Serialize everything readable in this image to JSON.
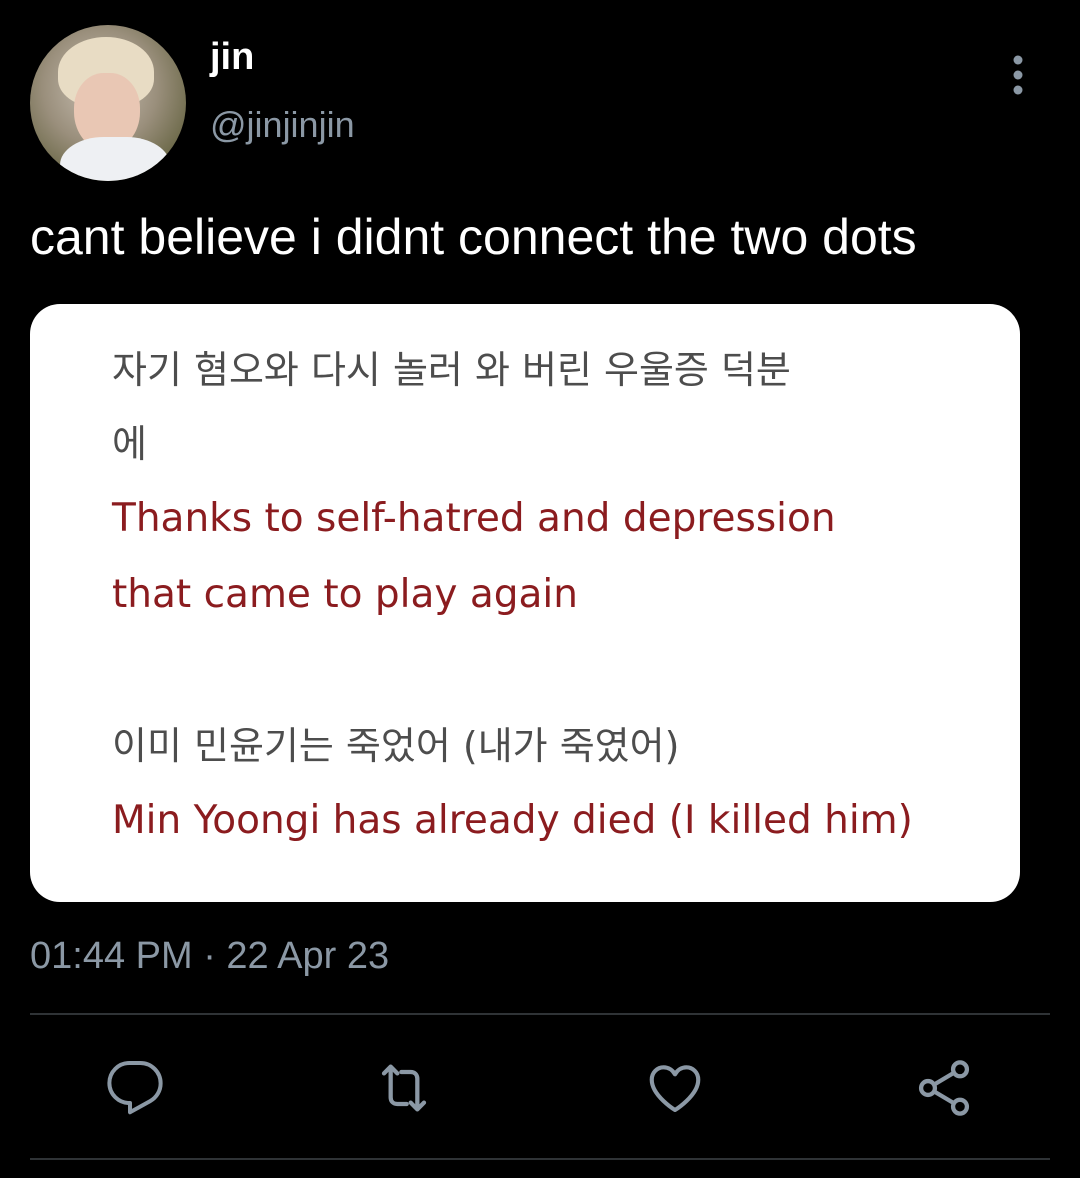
{
  "tweet": {
    "display_name": "jin",
    "handle": "@jinjinjin",
    "text": "cant believe i didnt connect the two dots",
    "timestamp": "01:44 PM · 22 Apr 23"
  },
  "media": {
    "lines": [
      {
        "text": "자기 혐오와 다시 놀러 와 버린 우울증 덕분",
        "lang": "ko"
      },
      {
        "text": "에",
        "lang": "ko"
      },
      {
        "text": "Thanks to self-hatred and depression",
        "lang": "en"
      },
      {
        "text": "that came to play again",
        "lang": "en"
      },
      {
        "text": "이미 민윤기는 죽었어 (내가 죽였어)",
        "lang": "ko"
      },
      {
        "text": "Min Yoongi has already died (I killed him)",
        "lang": "en"
      }
    ],
    "colors": {
      "korean": "#4d4d4d",
      "english": "#8b1c1f"
    }
  },
  "actions": [
    {
      "name": "reply",
      "icon": "reply-icon"
    },
    {
      "name": "retweet",
      "icon": "retweet-icon"
    },
    {
      "name": "like",
      "icon": "heart-icon"
    },
    {
      "name": "share",
      "icon": "share-icon"
    }
  ],
  "colors": {
    "background": "#000000",
    "text": "#ffffff",
    "secondary": "#8b98a5",
    "divider": "#2f3336"
  }
}
